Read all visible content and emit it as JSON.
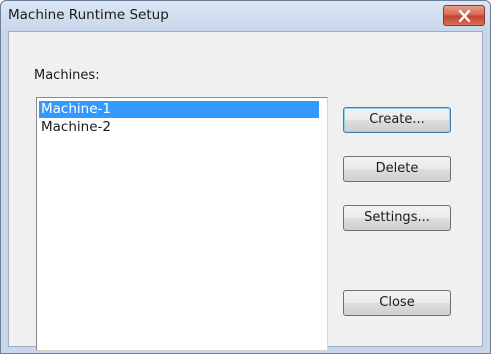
{
  "window": {
    "title": "Machine Runtime Setup",
    "close_icon": "close-x-icon"
  },
  "machines": {
    "label": "Machines:",
    "items": [
      {
        "name": "Machine-1",
        "selected": true
      },
      {
        "name": "Machine-2",
        "selected": false
      }
    ]
  },
  "buttons": {
    "create": "Create...",
    "delete": "Delete",
    "settings": "Settings...",
    "close": "Close"
  },
  "colors": {
    "selection": "#3399ff",
    "close_button": "#c7503a"
  }
}
